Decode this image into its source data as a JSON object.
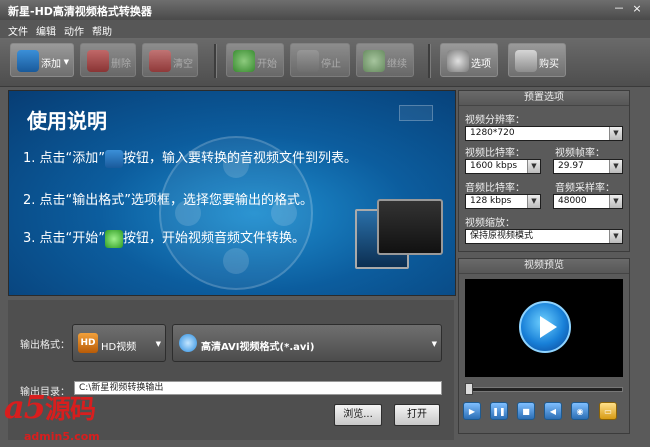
{
  "window": {
    "title": "新星-HD高清视频格式转换器",
    "min": "－",
    "close": "×"
  },
  "menu": [
    "文件",
    "编辑",
    "动作",
    "帮助"
  ],
  "toolbar": {
    "add": "添加",
    "delete": "删除",
    "clear": "清空",
    "start": "开始",
    "stop": "停止",
    "continue": "继续",
    "options": "选项",
    "buy": "购买"
  },
  "banner": {
    "title": "使用说明",
    "step1a": "1. 点击“添加”",
    "step1b": "按钮，输入要转换的音视频文件到列表。",
    "step2": "2. 点击“输出格式”选项框，选择您要输出的格式。",
    "step3a": "3. 点击“开始”",
    "step3b": "按钮，开始视频音频文件转换。"
  },
  "output": {
    "format_label": "输出格式：",
    "category": "HD视频",
    "hd_badge": "HD",
    "format": "高清AVI视频格式(*.avi)",
    "dir_label": "输出目录：",
    "dir_value": "C:\\新星视频转换输出",
    "browse": "浏览...",
    "open": "打开"
  },
  "preset": {
    "title": "预置选项",
    "resolution_label": "视频分辨率：",
    "resolution": "1280*720",
    "vbitrate_label": "视频比特率：",
    "vbitrate": "1600 kbps",
    "fps_label": "视频帧率：",
    "fps": "29.97",
    "abitrate_label": "音频比特率：",
    "abitrate": "128 kbps",
    "samplerate_label": "音频采样率：",
    "samplerate": "48000",
    "zoom_label": "视频缩放：",
    "zoom": "保持原视频模式"
  },
  "preview": {
    "title": "视频预览",
    "seek_position": 0.0
  },
  "watermark": {
    "logo": "a5",
    "logo_cn": "源码",
    "url": "admin5.com"
  },
  "colors": {
    "accent": "#1880d8",
    "bg": "#5a5a5a",
    "watermark": "#d81e1e"
  }
}
